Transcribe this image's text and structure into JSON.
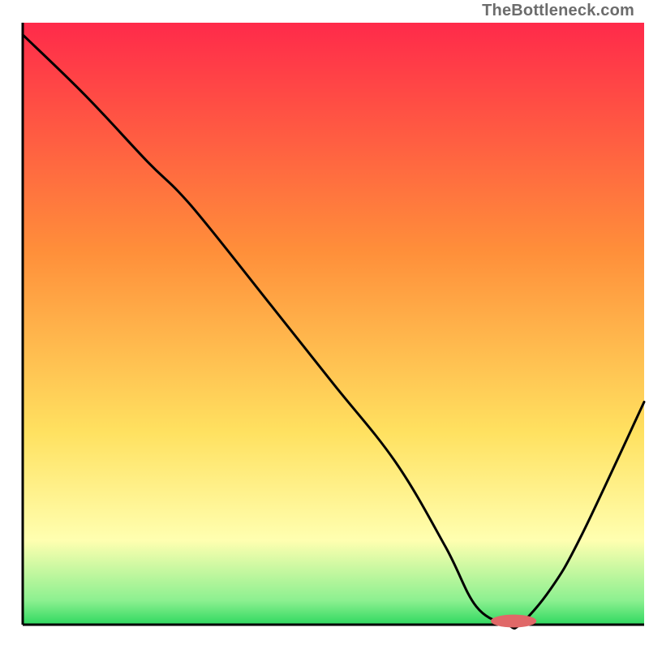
{
  "watermark": "TheBottleneck.com",
  "colors": {
    "gradient_top": "#ff2a4a",
    "gradient_mid_orange": "#ff8f3a",
    "gradient_yellow": "#ffe160",
    "gradient_pale_yellow": "#ffffb0",
    "gradient_green_light": "#8cf090",
    "gradient_green": "#2fd860",
    "axis": "#000000",
    "curve": "#000000",
    "marker_fill": "#e06868",
    "marker_stroke": "#e06868"
  },
  "chart_data": {
    "type": "line",
    "title": "",
    "xlabel": "",
    "ylabel": "",
    "xlim": [
      0,
      100
    ],
    "ylim": [
      0,
      100
    ],
    "x": [
      0,
      10,
      20,
      25,
      30,
      40,
      50,
      60,
      68,
      73,
      78,
      80,
      85,
      90,
      100
    ],
    "values": [
      98,
      88,
      77,
      72,
      66,
      53,
      40,
      27,
      13,
      3,
      0,
      0,
      6,
      15,
      37
    ],
    "marker": {
      "x": 79,
      "y": 0.6,
      "rx": 3.6,
      "ry": 1.0
    },
    "note": "x/y in chart coordinate space 0–100; y=0 is bottom (green), y=100 is top (red)."
  }
}
